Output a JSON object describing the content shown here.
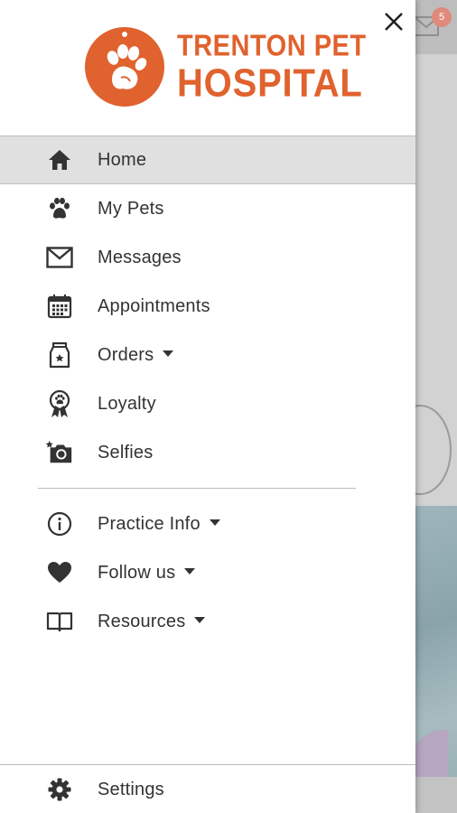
{
  "app": {
    "logo": {
      "line1": "TRENTON PET",
      "line2": "HOSPITAL",
      "color": "#e0622e"
    }
  },
  "background": {
    "badge_count": "5"
  },
  "menu": {
    "items": [
      {
        "label": "Home",
        "icon": "home-icon",
        "active": true
      },
      {
        "label": "My Pets",
        "icon": "paw-icon"
      },
      {
        "label": "Messages",
        "icon": "envelope-icon"
      },
      {
        "label": "Appointments",
        "icon": "calendar-icon"
      },
      {
        "label": "Orders",
        "icon": "pet-food-icon",
        "dropdown": true
      },
      {
        "label": "Loyalty",
        "icon": "loyalty-ribbon-icon"
      },
      {
        "label": "Selfies",
        "icon": "camera-icon"
      }
    ],
    "secondary": [
      {
        "label": "Practice Info",
        "icon": "info-icon",
        "dropdown": true
      },
      {
        "label": "Follow us",
        "icon": "heart-icon",
        "dropdown": true
      },
      {
        "label": "Resources",
        "icon": "book-icon",
        "dropdown": true
      }
    ],
    "settings": {
      "label": "Settings",
      "icon": "gear-icon"
    }
  },
  "colors": {
    "accent": "#e0622e",
    "active_bg": "#e0e0e0",
    "text": "#333333"
  }
}
